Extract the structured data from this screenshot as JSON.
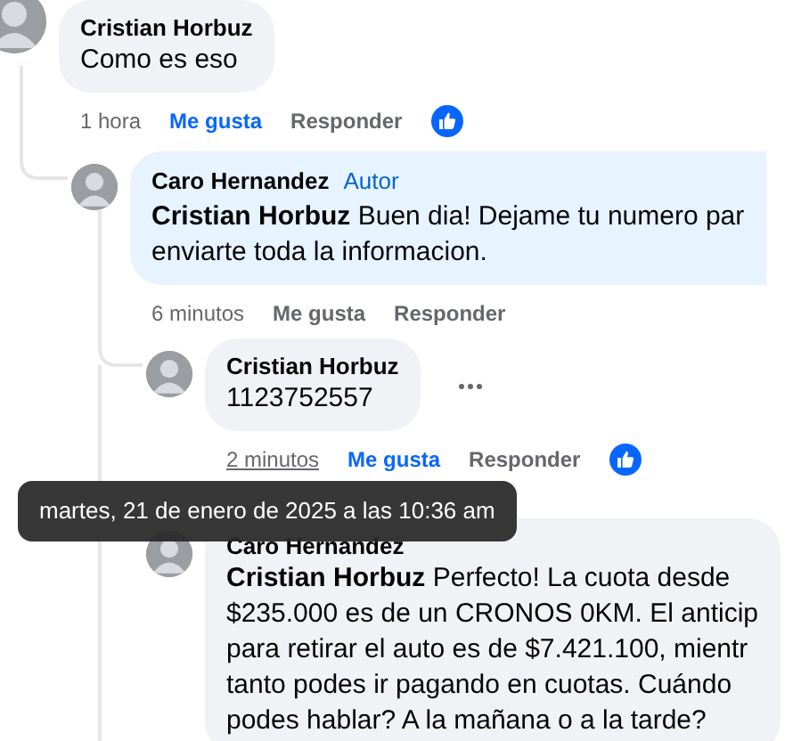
{
  "comments": [
    {
      "author": "Cristian Horbuz",
      "lines": [
        "Como es eso"
      ],
      "time": "1 hora",
      "time_hovered": false,
      "like_label": "Me gusta",
      "liked": true,
      "reply_label": "Responder",
      "reaction": true,
      "menu": false,
      "children": [
        {
          "author": "Caro Hernandez",
          "badge": "Autor",
          "lines": [
            "**Cristian Horbuz** Buen dia! Dejame tu numero par",
            "enviarte toda la informacion."
          ],
          "time": "6 minutos",
          "time_hovered": false,
          "like_label": "Me gusta",
          "liked": false,
          "reply_label": "Responder",
          "reaction": false,
          "menu": false,
          "children": [
            {
              "author": "Cristian Horbuz",
              "lines": [
                "1123752557"
              ],
              "time": "2 minutos",
              "time_hovered": true,
              "like_label": "Me gusta",
              "liked": true,
              "reply_label": "Responder",
              "reaction": true,
              "menu": true
            },
            {
              "author": "Caro Hernandez",
              "lines": [
                "**Cristian Horbuz** Perfecto! La cuota desde",
                "$235.000 es de un CRONOS 0KM. El anticip",
                "para retirar el auto es de $7.421.100, mientr",
                "tanto podes ir pagando en cuotas. Cuándo",
                "podes hablar? A la mañana o a la tarde?"
              ],
              "menu": false
            }
          ]
        }
      ]
    }
  ],
  "tooltip": "martes, 21 de enero de 2025 a las 10:36 am"
}
